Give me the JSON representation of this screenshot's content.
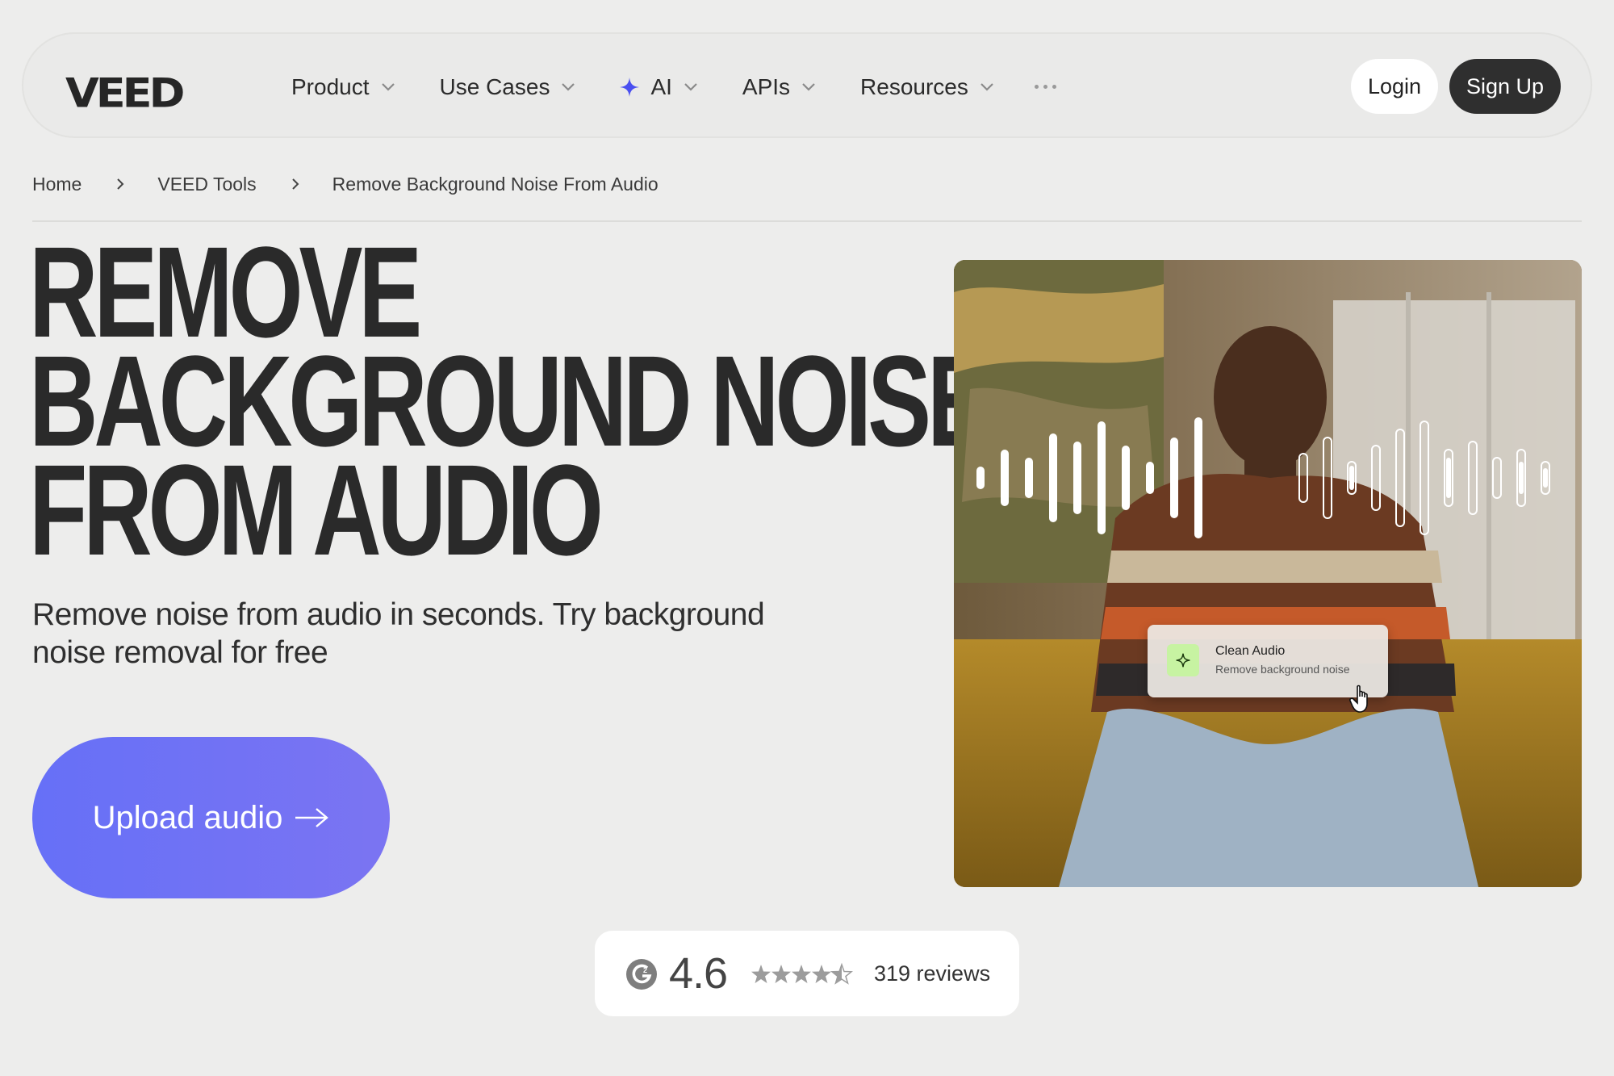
{
  "nav": {
    "logo": "VEED",
    "menu": [
      {
        "label": "Product"
      },
      {
        "label": "Use Cases"
      },
      {
        "label": "AI"
      },
      {
        "label": "APIs"
      },
      {
        "label": "Resources"
      }
    ],
    "login_label": "Login",
    "signup_label": "Sign Up"
  },
  "breadcrumb": {
    "home": "Home",
    "tools": "VEED Tools",
    "current": "Remove Background Noise From Audio"
  },
  "hero": {
    "title_lines": [
      "REMOVE",
      "BACKGROUND NOISE",
      "FROM AUDIO"
    ],
    "subtitle": "Remove noise from audio in seconds. Try background noise removal for free",
    "cta_label": "Upload audio",
    "card": {
      "title": "Clean Audio",
      "subtitle": "Remove background noise"
    }
  },
  "rating": {
    "value": "4.6",
    "stars": 4.5,
    "reviews": "319 reviews",
    "badge_icon": "g2-icon"
  },
  "colors": {
    "background": "#ededec",
    "cta": "#6670f7",
    "signup": "#2f2f2f",
    "ai_spark": "#4a4ff0",
    "card_icon": "#c7f3a2"
  }
}
